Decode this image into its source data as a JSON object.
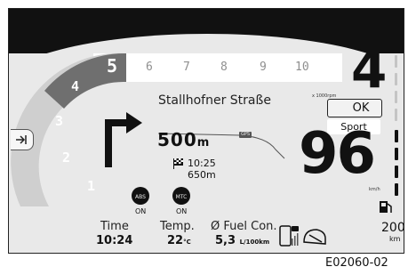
{
  "tachometer": {
    "scale_numbers": [
      "1",
      "2",
      "3",
      "4",
      "5",
      "6",
      "7",
      "8",
      "9",
      "10"
    ],
    "current_rpm_x1000": 5,
    "unit": "x 1000rpm"
  },
  "gear": {
    "value": "4"
  },
  "navigation": {
    "street_name": "Stallhofner Straße",
    "maneuver": "turn-right",
    "distance_value": "500",
    "distance_unit": "m",
    "gps_badge": "GPS",
    "arrival_time": "10:25",
    "remaining_distance": "650m",
    "destination_icon": "checkered-flag-icon"
  },
  "status": {
    "ok_label": "OK",
    "ok_icon": "temperature-icon",
    "riding_mode": "Sport"
  },
  "speed": {
    "value": "96",
    "unit": "km/h"
  },
  "indicators": [
    {
      "name": "ABS",
      "state": "ON"
    },
    {
      "name": "MTC",
      "state": "ON"
    }
  ],
  "fuel": {
    "range_value": "200",
    "range_unit": "km",
    "icon": "fuel-pump-icon"
  },
  "info_bar": {
    "time_label": "Time",
    "time_value": "10:24",
    "temp_label": "Temp.",
    "temp_value": "22",
    "temp_unit": "°C",
    "fuel_label": "Ø Fuel Con.",
    "fuel_value": "5,3",
    "fuel_unit": "L/100km",
    "phone_icon": "phone-signal-icon",
    "helmet_icon": "helmet-icon"
  },
  "menu_tab_icon": "menu-arrow-icon",
  "caption": "E02060-02",
  "colors": {
    "background": "#e9e9e9",
    "top_bar": "#111111",
    "active_arc": "#6f6f6f",
    "inactive": "#8f8f8f"
  }
}
